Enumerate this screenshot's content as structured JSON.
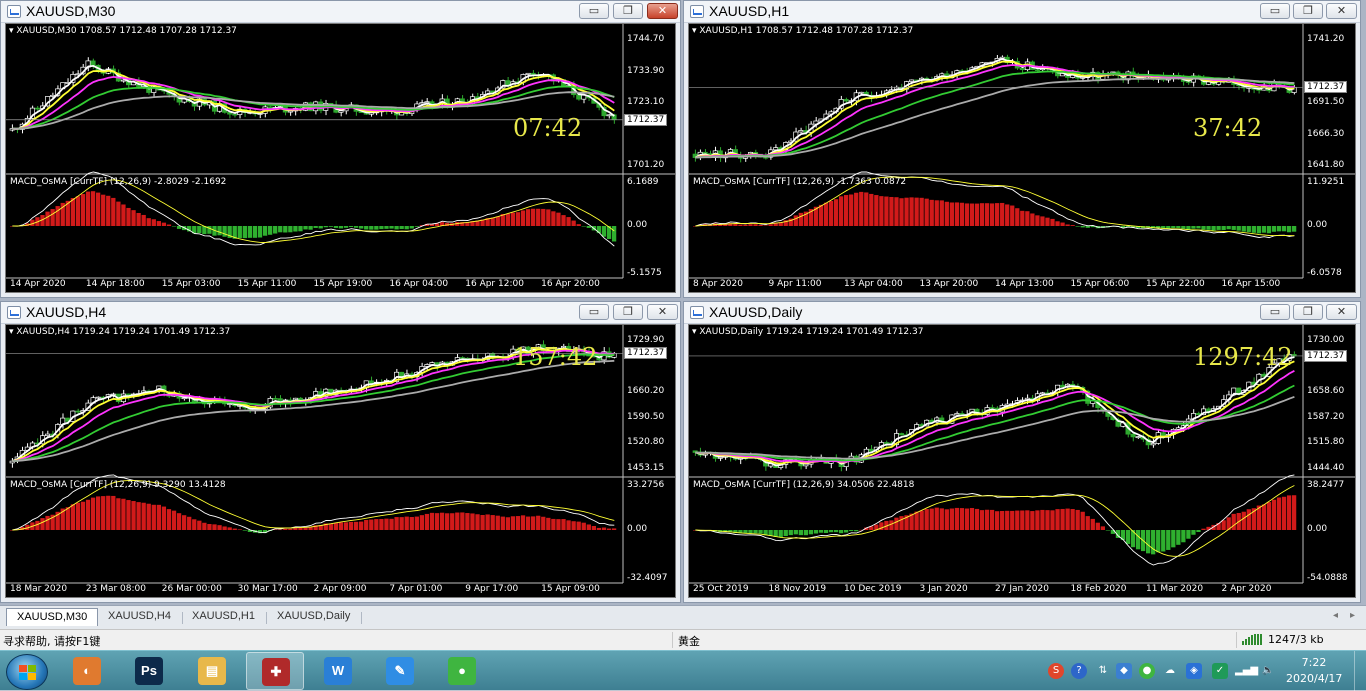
{
  "windows": [
    {
      "id": "m30",
      "title": "XAUUSD,M30",
      "active": true,
      "symbol_line": "XAUUSD,M30  1708.57 1712.48 1707.28 1712.37",
      "macd_line": "MACD_OsMA [CurrTF] (12,26,9) -2.8029 -2.1692",
      "timer": "07:42",
      "price_axis": [
        "1744.70",
        "1733.90",
        "1723.10",
        "1712.37",
        "1701.20"
      ],
      "current_price": "1712.37",
      "macd_axis": [
        "6.1689",
        "0.00",
        "-5.1575"
      ],
      "time_axis": [
        "14 Apr 2020",
        "14 Apr 18:00",
        "15 Apr 03:00",
        "15 Apr 11:00",
        "15 Apr 19:00",
        "16 Apr 04:00",
        "16 Apr 12:00",
        "16 Apr 20:00"
      ],
      "seed": 11
    },
    {
      "id": "h1",
      "title": "XAUUSD,H1",
      "active": false,
      "symbol_line": "XAUUSD,H1  1708.57 1712.48 1707.28 1712.37",
      "macd_line": "MACD_OsMA [CurrTF] (12,26,9) -1.7363 0.0872",
      "timer": "37:42",
      "price_axis": [
        "1741.20",
        "1712.37",
        "1691.50",
        "1666.30",
        "1641.80"
      ],
      "current_price": "1712.37",
      "macd_axis": [
        "11.9251",
        "0.00",
        "-6.0578"
      ],
      "time_axis": [
        "8 Apr 2020",
        "9 Apr 11:00",
        "13 Apr 04:00",
        "13 Apr 20:00",
        "14 Apr 13:00",
        "15 Apr 06:00",
        "15 Apr 22:00",
        "16 Apr 15:00"
      ],
      "seed": 23
    },
    {
      "id": "h4",
      "title": "XAUUSD,H4",
      "active": false,
      "symbol_line": "XAUUSD,H4  1719.24 1719.24 1701.49 1712.37",
      "macd_line": "MACD_OsMA [CurrTF] (12,26,9) 9.3290 13.4128",
      "timer": "157:42",
      "price_axis": [
        "1729.90",
        "1712.37",
        "1660.20",
        "1590.50",
        "1520.80",
        "1453.15"
      ],
      "current_price": "1712.37",
      "macd_axis": [
        "33.2756",
        "0.00",
        "-32.4097"
      ],
      "time_axis": [
        "18 Mar 2020",
        "23 Mar 08:00",
        "26 Mar 00:00",
        "30 Mar 17:00",
        "2 Apr 09:00",
        "7 Apr 01:00",
        "9 Apr 17:00",
        "15 Apr 09:00"
      ],
      "seed": 37
    },
    {
      "id": "daily",
      "title": "XAUUSD,Daily",
      "active": false,
      "symbol_line": "XAUUSD,Daily  1719.24 1719.24 1701.49 1712.37",
      "macd_line": "MACD_OsMA [CurrTF] (12,26,9) 34.0506 22.4818",
      "timer": "1297:42",
      "price_axis": [
        "1730.00",
        "1712.37",
        "1658.60",
        "1587.20",
        "1515.80",
        "1444.40"
      ],
      "current_price": "1712.37",
      "macd_axis": [
        "38.2477",
        "0.00",
        "-54.0888"
      ],
      "time_axis": [
        "25 Oct 2019",
        "18 Nov 2019",
        "10 Dec 2019",
        "3 Jan 2020",
        "27 Jan 2020",
        "18 Feb 2020",
        "11 Mar 2020",
        "2 Apr 2020"
      ],
      "seed": 53
    }
  ],
  "window_buttons": {
    "minimize": "▭",
    "restore": "❐",
    "close": "✕"
  },
  "tabs": [
    "XAUUSD,M30",
    "XAUUSD,H4",
    "XAUUSD,H1",
    "XAUUSD,Daily"
  ],
  "status": {
    "help": "寻求帮助, 请按F1键",
    "profile": "黄金",
    "traffic": "1247/3 kb"
  },
  "taskbar": {
    "apps": [
      {
        "name": "app-browser",
        "glyph": "◐",
        "color": "#e07a2f"
      },
      {
        "name": "app-photoshop",
        "glyph": "Ps",
        "color": "#0d2a4a"
      },
      {
        "name": "app-explorer",
        "glyph": "▤",
        "color": "#e8b84a"
      },
      {
        "name": "app-metatrader",
        "glyph": "✚",
        "color": "#b02a2a"
      },
      {
        "name": "app-wps-writer",
        "glyph": "W",
        "color": "#2a7fd6"
      },
      {
        "name": "app-note",
        "glyph": "✎",
        "color": "#2f8de4"
      },
      {
        "name": "app-wechat",
        "glyph": "●",
        "color": "#3fb540"
      }
    ],
    "time": "7:22",
    "date": "2020/4/17"
  },
  "colors": {
    "bull": "#ffffff",
    "bear": "#2fa82f",
    "macd_pos": "#d21a1a",
    "macd_neg": "#2fb02f",
    "ma_fast": "#ffffff",
    "ma_yellow": "#ffff33",
    "ma_magenta": "#ff33ff",
    "ma_green": "#33cc33",
    "ma_gray": "#aaaaaa",
    "timer": "#e8e84a"
  }
}
